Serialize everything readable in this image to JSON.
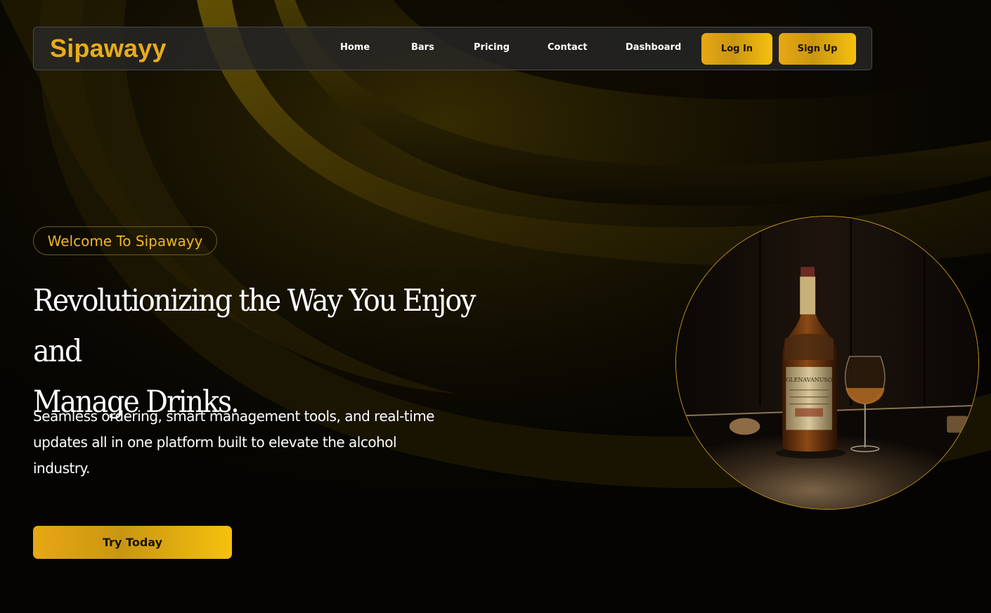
{
  "brand": {
    "name": "Sipawayy",
    "color": "#e8ac1b"
  },
  "nav": {
    "links": [
      {
        "label": "Home"
      },
      {
        "label": "Bars"
      },
      {
        "label": "Pricing"
      },
      {
        "label": "Contact"
      },
      {
        "label": "Dashboard"
      }
    ],
    "login_label": "Log In",
    "signup_label": "Sign Up"
  },
  "hero": {
    "badge": "Welcome To Sipawayy",
    "headline_line1": "Revolutionizing the Way You Enjoy and",
    "headline_line2": "Manage Drinks.",
    "subtext": "Seamless ordering, smart management tools, and real-time updates all in one platform built to elevate the alcohol industry.",
    "cta_label": "Try Today",
    "image_bottle_label": "GLENAVANUSO"
  },
  "colors": {
    "accent": "#f0b523",
    "button_gold": "#e7a714",
    "background": "#050402"
  }
}
